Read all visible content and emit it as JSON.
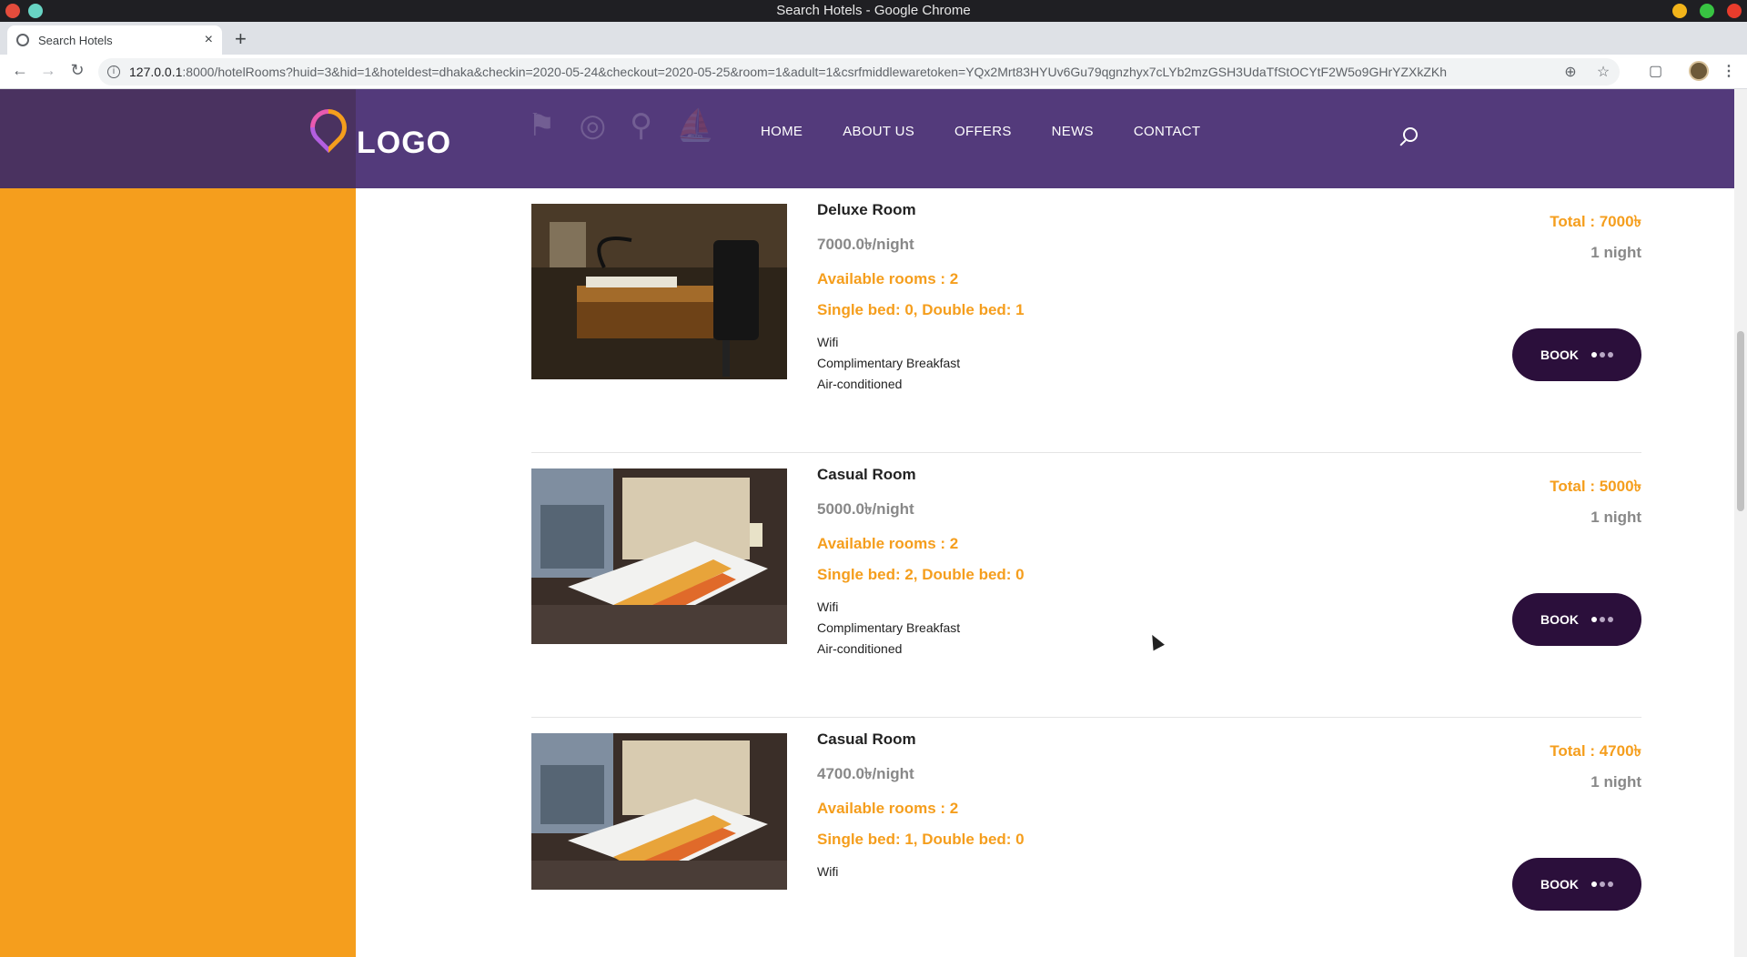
{
  "window": {
    "title": "Search Hotels - Google Chrome"
  },
  "tab": {
    "label": "Search Hotels",
    "close": "×",
    "new_tab": "+"
  },
  "omnibox": {
    "host": "127.0.0.1",
    "path": ":8000/hotelRooms?huid=3&hid=1&hoteldest=dhaka&checkin=2020-05-24&checkout=2020-05-25&room=1&adult=1&csrfmiddlewaretoken=YQx2Mrt83HYUv6Gu79qgnzhyx7cLYb2mzGSH3UdaTfStOCYtF2W5o9GHrYZXkZKh"
  },
  "site": {
    "logo_text": "LOGO",
    "nav": [
      "HOME",
      "ABOUT US",
      "OFFERS",
      "NEWS",
      "CONTACT"
    ]
  },
  "rooms": [
    {
      "name": "Deluxe Room",
      "price": "7000.0৳/night",
      "available": "Available rooms : 2",
      "beds": "Single bed: 0, Double bed: 1",
      "amenities": [
        "Wifi",
        "Complimentary Breakfast",
        "Air-conditioned"
      ],
      "total": "Total : 7000৳",
      "nights": "1 night",
      "book_label": "BOOK",
      "image": "desk-photo"
    },
    {
      "name": "Casual Room",
      "price": "5000.0৳/night",
      "available": "Available rooms : 2",
      "beds": "Single bed: 2, Double bed: 0",
      "amenities": [
        "Wifi",
        "Complimentary Breakfast",
        "Air-conditioned"
      ],
      "total": "Total : 5000৳",
      "nights": "1 night",
      "book_label": "BOOK",
      "image": "twin-bed-photo"
    },
    {
      "name": "Casual Room",
      "price": "4700.0৳/night",
      "available": "Available rooms : 2",
      "beds": "Single bed: 1, Double bed: 0",
      "amenities": [
        "Wifi"
      ],
      "total": "Total : 4700৳",
      "nights": "1 night",
      "book_label": "BOOK",
      "image": "twin-bed-photo"
    }
  ],
  "colors": {
    "header": "#533a7b",
    "sidebar": "#f59e1d",
    "accent": "#f59e1d",
    "book_button": "#2b0f3b"
  }
}
